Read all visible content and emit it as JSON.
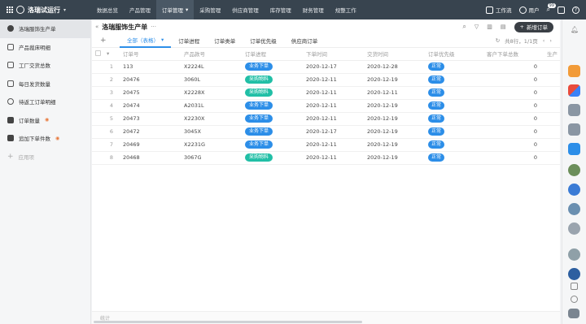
{
  "topbar": {
    "app_name": "洛瑞试运行",
    "nav": [
      {
        "label": "数据总览",
        "active": false
      },
      {
        "label": "产品管理",
        "active": false
      },
      {
        "label": "订单管理",
        "active": true
      },
      {
        "label": "采购管理",
        "active": false
      },
      {
        "label": "供应商管理",
        "active": false
      },
      {
        "label": "库存管理",
        "active": false
      },
      {
        "label": "财务管理",
        "active": false
      },
      {
        "label": "规整工作",
        "active": false
      }
    ],
    "workflow_label": "工作流",
    "user_label": "用户",
    "notification_count": "99"
  },
  "sidebar": {
    "items": [
      {
        "label": "洛瑞服饰生产单",
        "active": true,
        "icon": "dollar-icon"
      },
      {
        "label": "产品裁床明细",
        "active": false,
        "icon": "cart-icon"
      },
      {
        "label": "工厂交货总数",
        "active": false,
        "icon": "factory-icon"
      },
      {
        "label": "每日发货数量",
        "active": false,
        "icon": "box-icon"
      },
      {
        "label": "待返工订单明细",
        "active": false,
        "icon": "refresh-icon"
      },
      {
        "label": "订单数量",
        "active": false,
        "icon": "bag-icon"
      },
      {
        "label": "追加下单件数",
        "active": false,
        "icon": "list-icon"
      },
      {
        "label": "应用项",
        "active": false,
        "icon": "plus-icon"
      }
    ]
  },
  "header": {
    "title": "洛瑞服饰生产单",
    "more": "···",
    "new_button": "新增订单"
  },
  "tabs": {
    "items": [
      {
        "label": "全部（表格）",
        "active": true
      },
      {
        "label": "订单进程",
        "active": false
      },
      {
        "label": "订单类单",
        "active": false
      },
      {
        "label": "订单优先级",
        "active": false
      },
      {
        "label": "供应商订单",
        "active": false
      }
    ],
    "pager_text": "共8行，1/1页"
  },
  "table": {
    "headers": [
      "订单号",
      "产品款号",
      "订单进程",
      "下单时间",
      "交货时间",
      "订单优先级",
      "客户下单总数",
      "生产"
    ],
    "rows": [
      {
        "idx": "1",
        "order": "113",
        "sku": "X2224L",
        "status": "业务下单",
        "status_color": "blue",
        "order_date": "2020-12-17",
        "due_date": "2020-12-28",
        "priority": "正常",
        "total": "0"
      },
      {
        "idx": "2",
        "order": "20476",
        "sku": "3060L",
        "status": "采购物料",
        "status_color": "teal",
        "order_date": "2020-12-11",
        "due_date": "2020-12-19",
        "priority": "正常",
        "total": "0"
      },
      {
        "idx": "3",
        "order": "20475",
        "sku": "X2228X",
        "status": "采购物料",
        "status_color": "teal",
        "order_date": "2020-12-11",
        "due_date": "2020-12-11",
        "priority": "正常",
        "total": "0"
      },
      {
        "idx": "4",
        "order": "20474",
        "sku": "A2031L",
        "status": "业务下单",
        "status_color": "blue",
        "order_date": "2020-12-11",
        "due_date": "2020-12-19",
        "priority": "正常",
        "total": "0"
      },
      {
        "idx": "5",
        "order": "20473",
        "sku": "X2230X",
        "status": "业务下单",
        "status_color": "blue",
        "order_date": "2020-12-11",
        "due_date": "2020-12-19",
        "priority": "正常",
        "total": "0"
      },
      {
        "idx": "6",
        "order": "20472",
        "sku": "3045X",
        "status": "业务下单",
        "status_color": "blue",
        "order_date": "2020-12-17",
        "due_date": "2020-12-19",
        "priority": "正常",
        "total": "0"
      },
      {
        "idx": "7",
        "order": "20469",
        "sku": "X2231G",
        "status": "业务下单",
        "status_color": "blue",
        "order_date": "2020-12-11",
        "due_date": "2020-12-19",
        "priority": "正常",
        "total": "0"
      },
      {
        "idx": "8",
        "order": "20468",
        "sku": "3067G",
        "status": "采购物料",
        "status_color": "teal",
        "order_date": "2020-12-11",
        "due_date": "2020-12-19",
        "priority": "正常",
        "total": "0"
      }
    ]
  },
  "footer": {
    "label": "统计"
  },
  "colors": {
    "topbar": "#38444f",
    "accent": "#2c8ee8",
    "teal": "#21bfa6"
  }
}
